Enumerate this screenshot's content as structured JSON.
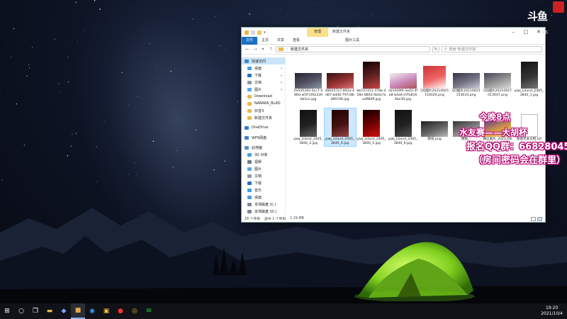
{
  "explorer": {
    "manage_tab": "管理",
    "title": "新建文件夹",
    "ribbon_tabs": [
      "文件",
      "主页",
      "共享",
      "查看",
      "图片工具"
    ],
    "path": "新建文件夹",
    "search_placeholder": "搜索\"新建文件夹\"",
    "nav": [
      {
        "label": "快速访问",
        "level": 0,
        "selected": true,
        "color": "#3a87d6"
      },
      {
        "label": "桌面",
        "level": 1,
        "pin": true,
        "color": "#4a9de0"
      },
      {
        "label": "下载",
        "level": 1,
        "pin": true,
        "color": "#2b6fc0"
      },
      {
        "label": "文档",
        "level": 1,
        "pin": true,
        "color": "#8d9aa8"
      },
      {
        "label": "图片",
        "level": 1,
        "pin": true,
        "color": "#5aa8e8"
      },
      {
        "label": "Download",
        "level": 1,
        "pin": false,
        "color": "#e8b94a"
      },
      {
        "label": "NARAKA_BLAD",
        "level": 1,
        "pin": false,
        "color": "#e8b94a"
      },
      {
        "label": "抖音3",
        "level": 1,
        "pin": false,
        "color": "#e8b94a"
      },
      {
        "label": "新建文件夹",
        "level": 1,
        "pin": false,
        "color": "#e8b94a"
      },
      {
        "gap": true
      },
      {
        "label": "OneDrive",
        "level": 0,
        "selected": false,
        "color": "#2d7de0"
      },
      {
        "gap": true
      },
      {
        "label": "WPS网盘",
        "level": 0,
        "selected": false,
        "color": "#3c82d8"
      },
      {
        "gap": true
      },
      {
        "label": "此电脑",
        "level": 0,
        "selected": false,
        "color": "#5a8fc8"
      },
      {
        "label": "3D 对象",
        "level": 1,
        "pin": false,
        "color": "#4aa0d8"
      },
      {
        "label": "视频",
        "level": 1,
        "pin": false,
        "color": "#6b7b8c"
      },
      {
        "label": "图片",
        "level": 1,
        "pin": false,
        "color": "#5aa8e8"
      },
      {
        "label": "文档",
        "level": 1,
        "pin": false,
        "color": "#8d9aa8"
      },
      {
        "label": "下载",
        "level": 1,
        "pin": false,
        "color": "#2b6fc0"
      },
      {
        "label": "音乐",
        "level": 1,
        "pin": false,
        "color": "#3aa0e0"
      },
      {
        "label": "桌面",
        "level": 1,
        "pin": false,
        "color": "#4a9de0"
      },
      {
        "label": "本地磁盘 (C:)",
        "level": 1,
        "pin": false,
        "color": "#7a8a98"
      },
      {
        "label": "本地磁盘 (D:)",
        "level": 1,
        "pin": false,
        "color": "#7a8a98"
      }
    ],
    "files": [
      {
        "name": "0e545392-0cc7-486d-af3f-20fa339bb1ce.jpg",
        "kind": "wide",
        "palette": [
          "#223",
          "#556",
          "#89a"
        ],
        "selected": false
      },
      {
        "name": "48035727-891a-4d87-bdd6-797c8bd897d6.jpg",
        "kind": "wide",
        "palette": [
          "#311",
          "#933",
          "#d77"
        ],
        "selected": false
      },
      {
        "name": "bb747251-37bb-428e-884d-4b0a7aad9809.jpg",
        "kind": "tall",
        "palette": [
          "#100",
          "#622",
          "#c44"
        ],
        "selected": false
      },
      {
        "name": "cb1929f0-3e42-4fe8-b4a6-d7fa8166be30.jpg",
        "kind": "wide",
        "palette": [
          "#eee",
          "#c8b",
          "#a55"
        ],
        "selected": false
      },
      {
        "name": "QQ图片20210925154020.png",
        "kind": "square",
        "palette": [
          "#c33",
          "#e66",
          "#fff"
        ],
        "selected": false
      },
      {
        "name": "QQ图片20210925154033.png",
        "kind": "wide",
        "palette": [
          "#334",
          "#778",
          "#ccd"
        ],
        "selected": false
      },
      {
        "name": "QQ图片20210927013447.png",
        "kind": "wide",
        "palette": [
          "#445",
          "#999",
          "#ddd"
        ],
        "selected": false
      },
      {
        "name": "yjwj_inland_2465_3840_1.jpg",
        "kind": "tall",
        "palette": [
          "#111",
          "#333",
          "#777"
        ],
        "selected": false
      },
      {
        "name": "yjwj_inland_2465_3840_2.jpg",
        "kind": "tall",
        "palette": [
          "#111",
          "#222",
          "#666"
        ],
        "selected": false
      },
      {
        "name": "yjwj_inland_2465_3840_4.jpg",
        "kind": "tall",
        "palette": [
          "#200",
          "#411",
          "#944"
        ],
        "selected": true
      },
      {
        "name": "yjwj_inland_2465_3840_5.jpg",
        "kind": "tall",
        "palette": [
          "#100",
          "#700",
          "#c11"
        ],
        "selected": false
      },
      {
        "name": "yjwj_inland_2465_3840_6.jpg",
        "kind": "tall",
        "palette": [
          "#111",
          "#222",
          "#555"
        ],
        "selected": false
      },
      {
        "name": "壁纸.png",
        "kind": "wide",
        "palette": [
          "#222",
          "#666",
          "#bbb"
        ],
        "selected": false
      },
      {
        "name": "真我...",
        "kind": "wide",
        "palette": [
          "#333",
          "#888",
          "#ccc"
        ],
        "selected": false
      },
      {
        "name": "微信图片_20211001184107.png",
        "kind": "wide",
        "palette": [
          "#6a3a8a",
          "#d8a040",
          "#f0d070"
        ],
        "selected": false
      },
      {
        "name": "新建文本文档.txt",
        "kind": "doc",
        "palette": [
          "#fff",
          "#ddd",
          "#bbb"
        ],
        "selected": false
      }
    ],
    "status": {
      "count": "18 个项目",
      "selected": "选中 1 个项目",
      "size": "1.29 MB"
    }
  },
  "overlay": {
    "logo_mark": "斗鱼",
    "logo_number": "96",
    "lines": [
      "今晚8点",
      "水友赛——大胡杯",
      "报名QQ群：668280453",
      "（房间密码会在群里）"
    ]
  },
  "taskbar": {
    "time": "19:20",
    "date": "2021/10/4",
    "icons": [
      "windows-icon",
      "cortana-icon",
      "taskview-icon",
      "file-explorer-icon",
      "naraka-icon",
      "folder-app-icon",
      "edge-icon",
      "game-box-icon",
      "netease-icon",
      "chrome-icon",
      "wechat-icon"
    ],
    "active": "folder-app-icon"
  }
}
